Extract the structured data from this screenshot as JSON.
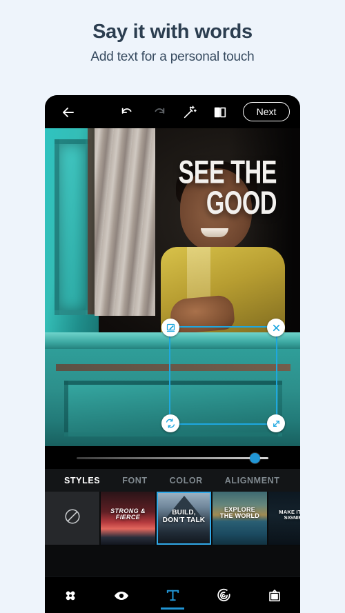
{
  "promo": {
    "title": "Say it with words",
    "subtitle": "Add text for a personal touch"
  },
  "colors": {
    "page_background": "#eef4fb",
    "accent_blue": "#2196d6",
    "selection_blue": "#1ea7e0",
    "app_background": "#000000",
    "panel_background": "#131517",
    "inactive_tab": "#818a90"
  },
  "toolbar": {
    "back_icon": "back-arrow-icon",
    "undo_icon": "undo-icon",
    "redo_icon": "redo-icon",
    "magic_icon": "magic-wand-icon",
    "compare_icon": "compare-split-icon",
    "next_label": "Next"
  },
  "canvas": {
    "overlay_text_line1": "SEE THE",
    "overlay_text_line2": "GOOD",
    "handles": {
      "edit": "edit-pencil-icon",
      "close": "close-x-icon",
      "rotate": "rotate-flip-icon",
      "resize": "resize-diagonal-icon"
    }
  },
  "slider": {
    "value_percent": 93,
    "name": "opacity-slider"
  },
  "tabs": [
    {
      "label": "STYLES",
      "active": true
    },
    {
      "label": "FONT",
      "active": false
    },
    {
      "label": "COLOR",
      "active": false
    },
    {
      "label": "ALIGNMENT",
      "active": false
    }
  ],
  "styles": [
    {
      "id": "none",
      "label": "",
      "icon": "no-style-icon",
      "selected": false
    },
    {
      "id": "strong-fierce",
      "label": "STRONG &\nFIERCE",
      "selected": false
    },
    {
      "id": "build-dont-talk",
      "label": "BUILD,\nDON'T TALK",
      "selected": true
    },
    {
      "id": "explore-the-world",
      "label": "EXPLORE\nTHE WORLD",
      "selected": false
    },
    {
      "id": "make-it-simple",
      "label": "MAKE IT SIM\nSIGNIFIC",
      "selected": false
    }
  ],
  "bottom_nav": [
    {
      "id": "heal",
      "icon": "healing-patch-icon",
      "active": false
    },
    {
      "id": "looks",
      "icon": "eye-icon",
      "active": false
    },
    {
      "id": "text",
      "icon": "text-t-icon",
      "active": true
    },
    {
      "id": "blur",
      "icon": "spiral-blur-icon",
      "active": false
    },
    {
      "id": "frame",
      "icon": "frame-icon",
      "active": false
    }
  ]
}
